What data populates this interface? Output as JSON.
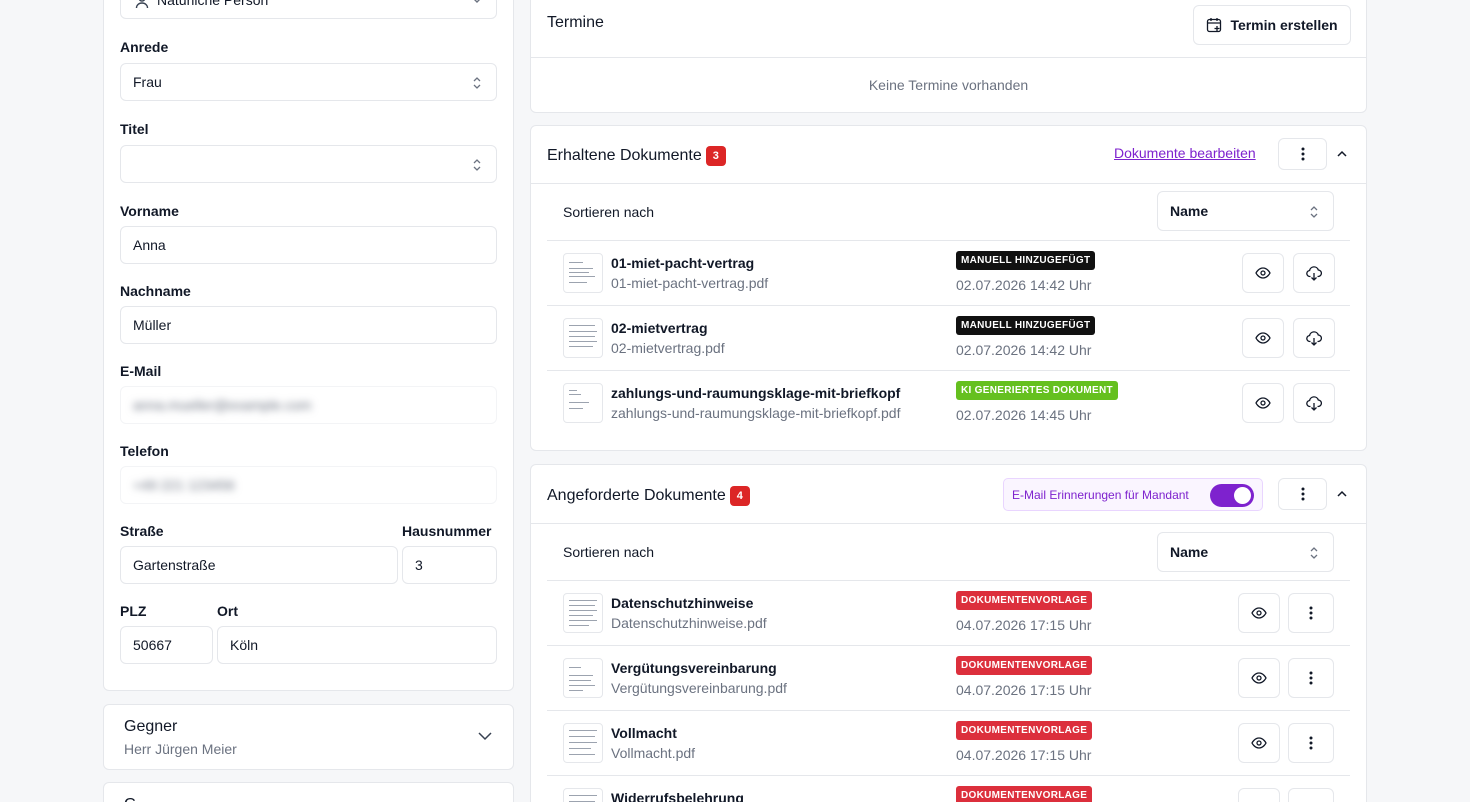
{
  "person": {
    "type_value": "Natürliche Person",
    "salutation": {
      "label": "Anrede",
      "value": "Frau"
    },
    "title": {
      "label": "Titel",
      "value": ""
    },
    "first_name": {
      "label": "Vorname",
      "value": "Anna"
    },
    "last_name": {
      "label": "Nachname",
      "value": "Müller"
    },
    "email": {
      "label": "E-Mail",
      "value": "anna.mueller@example.com"
    },
    "phone": {
      "label": "Telefon",
      "value": "+49 221 123456"
    },
    "street": {
      "label": "Straße",
      "value": "Gartenstraße"
    },
    "house_number": {
      "label": "Hausnummer",
      "value": "3"
    },
    "zip": {
      "label": "PLZ",
      "value": "50667"
    },
    "city": {
      "label": "Ort",
      "value": "Köln"
    }
  },
  "opponent": {
    "title": "Gegner",
    "subtitle": "Herr Jürgen Meier"
  },
  "next_section": {
    "title": "G"
  },
  "appointments": {
    "title": "Termine",
    "create_label": "Termin erstellen",
    "empty_text": "Keine Termine vorhanden"
  },
  "received": {
    "title": "Erhaltene Dokumente",
    "count": "3",
    "edit_link": "Dokumente bearbeiten",
    "sort_label": "Sortieren nach",
    "sort_value": "Name",
    "rows": [
      {
        "title": "01-miet-pacht-vertrag",
        "file": "01-miet-pacht-vertrag.pdf",
        "tag": "MANUELL HINZUGEFÜGT",
        "date": "02.07.2026 14:42 Uhr"
      },
      {
        "title": "02-mietvertrag",
        "file": "02-mietvertrag.pdf",
        "tag": "MANUELL HINZUGEFÜGT",
        "date": "02.07.2026 14:42 Uhr"
      },
      {
        "title": "zahlungs-und-raumungsklage-mit-briefkopf",
        "file": "zahlungs-und-raumungsklage-mit-briefkopf.pdf",
        "tag": "KI GENERIERTES DOKUMENT",
        "date": "02.07.2026 14:45 Uhr"
      }
    ]
  },
  "requested": {
    "title": "Angeforderte Dokumente",
    "count": "4",
    "reminder_label": "E-Mail Erinnerungen für Mandant",
    "reminder_on": true,
    "sort_label": "Sortieren nach",
    "sort_value": "Name",
    "rows": [
      {
        "title": "Datenschutzhinweise",
        "file": "Datenschutzhinweise.pdf",
        "tag": "DOKUMENTENVORLAGE",
        "date": "04.07.2026 17:15 Uhr"
      },
      {
        "title": "Vergütungsvereinbarung",
        "file": "Vergütungsvereinbarung.pdf",
        "tag": "DOKUMENTENVORLAGE",
        "date": "04.07.2026 17:15 Uhr"
      },
      {
        "title": "Vollmacht",
        "file": "Vollmacht.pdf",
        "tag": "DOKUMENTENVORLAGE",
        "date": "04.07.2026 17:15 Uhr"
      },
      {
        "title": "Widerrufsbelehrung",
        "file": "",
        "tag": "DOKUMENTENVORLAGE",
        "date": ""
      }
    ]
  },
  "colors": {
    "accent": "#7e22ce",
    "badge_red": "#dc2626",
    "tag_green": "#65c01f",
    "tag_black": "#111111"
  }
}
